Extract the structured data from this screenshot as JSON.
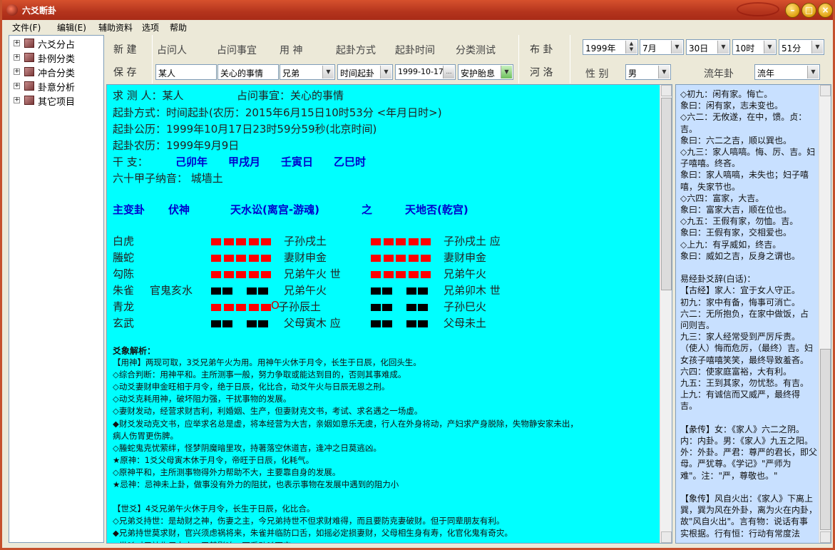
{
  "window": {
    "title": "六爻断卦"
  },
  "menu": [
    "文件(F)",
    "编辑(E)",
    "辅助资料",
    "选项",
    "帮助"
  ],
  "tree": [
    "六爻分占",
    "卦例分类",
    "冲合分类",
    "卦意分析",
    "其它项目"
  ],
  "toolbar": {
    "new": "新 建",
    "save": "保 存",
    "querent_label": "占问人",
    "matter_label": "占问事宜",
    "yongshen_label": "用 神",
    "method_label": "起卦方式",
    "time_label": "起卦时间",
    "category_label": "分类测试",
    "querent": "某人",
    "matter": "关心的事情",
    "yongshen": "兄弟",
    "method": "时间起卦",
    "time": "1999-10-17",
    "category": "安护胎息",
    "bugua": "布 卦",
    "heluo": "河 洛",
    "year": "1999年",
    "month": "7月",
    "day": "30日",
    "hour": "10时",
    "minute": "51分",
    "gender_label": "性 别",
    "gender": "男",
    "liunian_label": "流年卦",
    "liunian": "流年"
  },
  "reading": {
    "l1": "求 测 人：某人",
    "l1b": "占问事宜：关心的事情",
    "l2": "起卦方式：时间起卦(农历：2015年6月15日10时53分 <年月日时>)",
    "l3": "起卦公历：1999年10月17日23时59分59秒(北京时间)",
    "l4": "起卦农历：1999年9月9日",
    "l5_label": "干    支：",
    "gz": [
      "己卯年",
      "甲戌月",
      "壬寅日",
      "乙巳时"
    ],
    "l6": "六十甲子纳音：    城墙土",
    "hdr": [
      "主变卦",
      "伏神",
      "天水讼(离宫-游魂)",
      "之",
      "天地否(乾宫)"
    ],
    "rows": [
      {
        "god": "白虎",
        "fu": "",
        "main": "子孙戌土",
        "chg": "子孙戌土  应"
      },
      {
        "god": "螣蛇",
        "fu": "",
        "main": "妻财申金",
        "chg": "妻财申金"
      },
      {
        "god": "勾陈",
        "fu": "",
        "main": "兄弟午火  世",
        "chg": "兄弟午火"
      },
      {
        "god": "朱雀",
        "fu": "官鬼亥水",
        "main": "兄弟午火",
        "chg": "兄弟卯木  世"
      },
      {
        "god": "青龙",
        "fu": "",
        "main": "子孙辰土",
        "mark": "O",
        "chg": "子孙巳火"
      },
      {
        "god": "玄武",
        "fu": "",
        "main": "父母寅木  应",
        "chg": "父母未土"
      }
    ],
    "analysis_title": "爻象解析：",
    "analysis": [
      "【用神】两现可取，3爻兄弟午火为用。用神午火休于月令，长生于日辰，化回头生。",
      "  ◇综合判断：用神平和。主所测事一般，努力争取或能达到目的，否则其事难成。",
      "  ◇动爻妻财申金旺相于月令，绝于日辰，化比合，动爻午火与日辰无恩之刑。",
      "  ◇动爻克耗用神，破坏阻力强，干扰事物的发展。",
      "  ◇妻财发动，经营求财吉利，利婚姻、生产，但妻财克文书，考试、求名遇之一场虚。",
      "  ◆财爻发动克文书，应举求名总是虚，将本经营为大吉，亲姻如意乐无虞，行人在外身将动，产妇求产身脱除，失物静安家未出，",
      "病人伤胃更伤脾。",
      "  ◇螣蛇鬼克忧萦绊，怪梦阴魔暗里攻，持著落空休道吉，逢冲之日莫逃凶。",
      "  ★原神：1爻父母寅木休于月令，帝旺于日辰，化耗气。",
      "  ◇原神平和，主所测事物得外力帮助不大，主要靠自身的发展。",
      "  ★忌神：忌神未上卦，做事没有外力的阻扰，也表示事物在发展中遇到的阻力小",
      "",
      "【世爻】4爻兄弟午火休于月令，长生于日辰，化比合。",
      "  ◇兄弟爻持世：是劫财之神，伤妻之主，今兄弟持世不但求财难得，而且要防克妻破财。但于同辈朋友有利。",
      "  ◆兄弟持世莫求财，官兴须虑祸将来，朱雀并临防口舌，如摇必定损妻财，父母相生身有寿，化官化鬼有奇灾。",
      "  ◇世爻对用神作用力小，无甚影响，可看动爻而定。"
    ]
  },
  "notes": [
    "◇初九：闲有家。悔亡。",
    "   象曰：闲有家，志未变也。",
    "◇六二：无攸遂，在中，馈。贞：",
    "吉。",
    "   象曰：六二之吉，顺以巽也。",
    "◇九三：家人嗃嗃。悔、厉、吉。妇",
    "子嘻嘻。终吝。",
    "   象曰：家人嗃嗃，未失也；妇子嘻",
    "嘻，失家节也。",
    "◇六四：富家，大吉。",
    "   象曰：富家大吉，顺在位也。",
    "◇九五：王假有家，勿恤。吉。",
    "   象曰：王假有家，交相爱也。",
    "◇上九：有孚威如，终吉。",
    "   象曰：威如之吉，反身之谓也。",
    "",
    "易经卦爻辞(白话)：",
    "【古经】家人：宜于女人守正。",
    "   初九：家中有备，悔事可消亡。",
    "   六二：无所抱负，在家中做饭，占",
    "问则吉。",
    "   九三：家人经常受到严厉斥责。",
    "（使人）悔而危厉，（最终）吉。妇",
    "女孩子嘻嘻笑笑，最终导致羞吝。",
    "   六四：使家庭富裕，大有利。",
    "   九五：王到其家，勿忧愁。有吉。",
    "   上九：有诚信而又威严，最终得",
    "吉。",
    "",
    "【彖传】女：《家人》六二之阴。",
    "内：内卦。男：《家人》九五之阳。",
    "外：外卦。严君：尊严的君长，即父",
    "母。严犹尊。《学记》\"严师为",
    "难\"。注：\"严，尊敬也。\"",
    "",
    "【象传】风自火出：《家人》下离上",
    "巽，巽为风在外卦，离为火在内卦，",
    "故\"风自火出\"。言有物：说话有事",
    "实根据。行有恒：行动有常度法"
  ],
  "colors": {
    "yang": "#ff0000",
    "yin_changed": "#000000",
    "accent": "#0000cc",
    "bg_main": "#00ffff",
    "bg_notes": "#c8e0ff"
  }
}
